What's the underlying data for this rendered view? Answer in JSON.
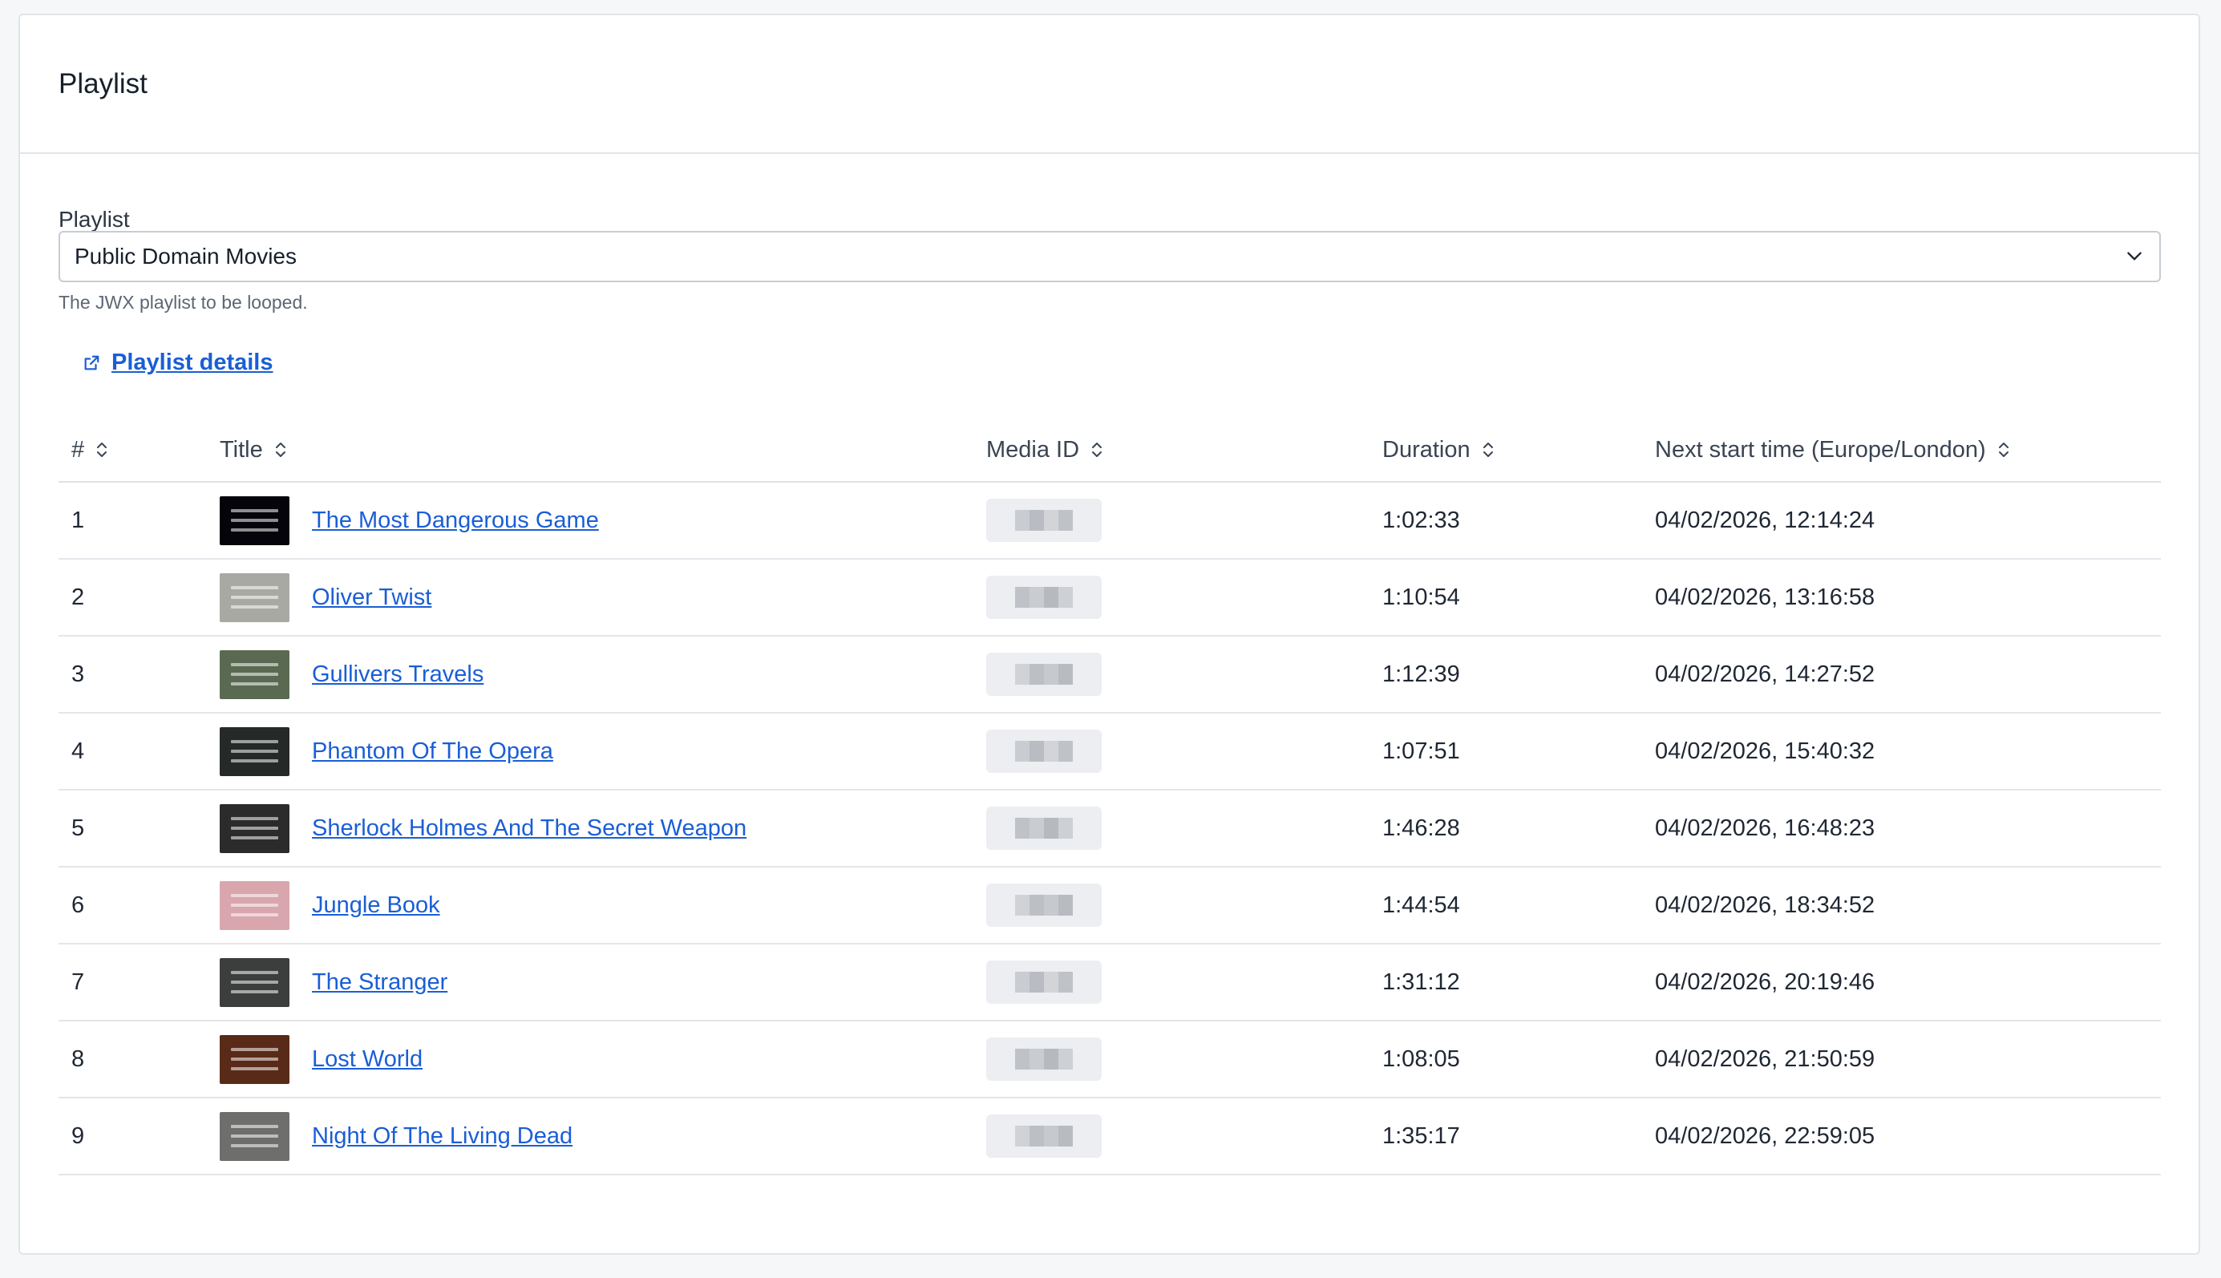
{
  "card": {
    "title": "Playlist"
  },
  "field": {
    "label": "Playlist",
    "selected_value": "Public Domain Movies",
    "help_text": "The JWX playlist to be looped."
  },
  "details_link": {
    "label": "Playlist details",
    "icon": "external-link-icon"
  },
  "table": {
    "headers": [
      "#",
      "Title",
      "Media ID",
      "Duration",
      "Next start time (Europe/London)"
    ],
    "rows": [
      {
        "num": "1",
        "title": "The Most Dangerous Game",
        "duration": "1:02:33",
        "next_start": "04/02/2026, 12:14:24",
        "thumb_color": "#05040a"
      },
      {
        "num": "2",
        "title": "Oliver Twist",
        "duration": "1:10:54",
        "next_start": "04/02/2026, 13:16:58",
        "thumb_color": "#a9a9a4"
      },
      {
        "num": "3",
        "title": "Gullivers Travels",
        "duration": "1:12:39",
        "next_start": "04/02/2026, 14:27:52",
        "thumb_color": "#5a6a52"
      },
      {
        "num": "4",
        "title": "Phantom Of The Opera",
        "duration": "1:07:51",
        "next_start": "04/02/2026, 15:40:32",
        "thumb_color": "#252a28"
      },
      {
        "num": "5",
        "title": "Sherlock Holmes And The Secret Weapon",
        "duration": "1:46:28",
        "next_start": "04/02/2026, 16:48:23",
        "thumb_color": "#2b2b2b"
      },
      {
        "num": "6",
        "title": "Jungle Book",
        "duration": "1:44:54",
        "next_start": "04/02/2026, 18:34:52",
        "thumb_color": "#d9a6ad"
      },
      {
        "num": "7",
        "title": "The Stranger",
        "duration": "1:31:12",
        "next_start": "04/02/2026, 20:19:46",
        "thumb_color": "#3b3e3c"
      },
      {
        "num": "8",
        "title": "Lost World",
        "duration": "1:08:05",
        "next_start": "04/02/2026, 21:50:59",
        "thumb_color": "#5a2a18"
      },
      {
        "num": "9",
        "title": "Night Of The Living Dead",
        "duration": "1:35:17",
        "next_start": "04/02/2026, 22:59:05",
        "thumb_color": "#6e6f6c"
      }
    ]
  }
}
